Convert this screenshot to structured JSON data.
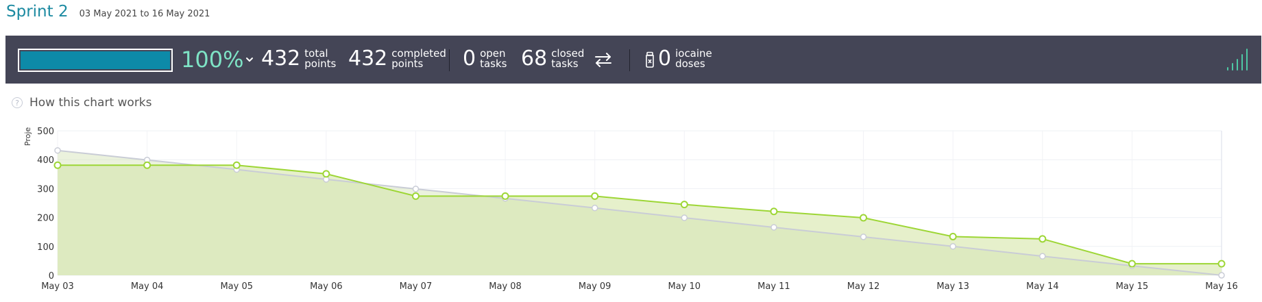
{
  "sprint": {
    "title": "Sprint 2",
    "dates": "03 May 2021 to 16 May 2021"
  },
  "stats": {
    "progress_percent": 100,
    "progress_label": "100%",
    "total_points": "432",
    "total_label_1": "total",
    "total_label_2": "points",
    "completed_points": "432",
    "completed_label_1": "completed",
    "completed_label_2": "points",
    "open_tasks": "0",
    "open_label_1": "open",
    "open_label_2": "tasks",
    "closed_tasks": "68",
    "closed_label_1": "closed",
    "closed_label_2": "tasks",
    "iocaine_doses": "0",
    "iocaine_label_1": "iocaine",
    "iocaine_label_2": "doses"
  },
  "help": {
    "label": "How this chart works"
  },
  "icons": [
    "chevron-down-icon",
    "swap-icon",
    "iocaine-jar-icon",
    "bar-graph-icon",
    "help-icon"
  ],
  "colors": {
    "accent": "#1c8aa1",
    "bar_bg": "#444556",
    "progress": "#0d8aa8",
    "percent": "#7ee3c5",
    "real_line": "#9dd635",
    "ideal_line": "#c9ccd6"
  },
  "chart_data": {
    "type": "area",
    "ylabel": "Proje",
    "ylim": [
      0,
      500
    ],
    "yticks": [
      0,
      100,
      200,
      300,
      400,
      500
    ],
    "grid": true,
    "categories": [
      "May 03",
      "May 04",
      "May 05",
      "May 06",
      "May 07",
      "May 08",
      "May 09",
      "May 10",
      "May 11",
      "May 12",
      "May 13",
      "May 14",
      "May 15",
      "May 16"
    ],
    "series": [
      {
        "values": [
          432,
          399,
          366,
          332,
          299,
          266,
          233,
          199,
          166,
          133,
          100,
          66,
          33,
          0
        ]
      },
      {
        "values": [
          381,
          381,
          381,
          351,
          274,
          274,
          274,
          245,
          221,
          199,
          134,
          126,
          40,
          40
        ]
      }
    ]
  }
}
